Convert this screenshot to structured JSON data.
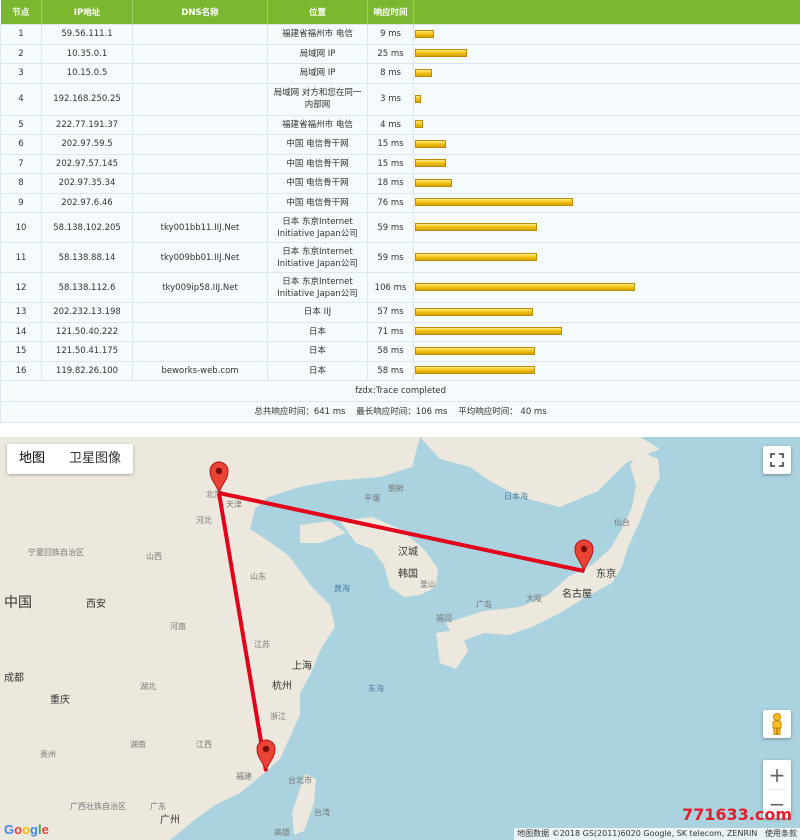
{
  "table": {
    "headers": [
      "节点",
      "IP地址",
      "DNS名称",
      "位置",
      "响应时间",
      ""
    ],
    "max_ms": 106,
    "rows": [
      {
        "hop": "1",
        "ip": "59.56.111.1",
        "dns": "",
        "loc": "福建省福州市 电信",
        "time": "9 ms",
        "ms": 9
      },
      {
        "hop": "2",
        "ip": "10.35.0.1",
        "dns": "",
        "loc": "局域网 IP",
        "time": "25 ms",
        "ms": 25
      },
      {
        "hop": "3",
        "ip": "10.15.0.5",
        "dns": "",
        "loc": "局域网 IP",
        "time": "8 ms",
        "ms": 8
      },
      {
        "hop": "4",
        "ip": "192.168.250.25",
        "dns": "",
        "loc": "局域网 对方和您在同一内部网",
        "time": "3 ms",
        "ms": 3
      },
      {
        "hop": "5",
        "ip": "222.77.191.37",
        "dns": "",
        "loc": "福建省福州市 电信",
        "time": "4 ms",
        "ms": 4
      },
      {
        "hop": "6",
        "ip": "202.97.59.5",
        "dns": "",
        "loc": "中国 电信骨干网",
        "time": "15 ms",
        "ms": 15
      },
      {
        "hop": "7",
        "ip": "202.97.57.145",
        "dns": "",
        "loc": "中国 电信骨干网",
        "time": "15 ms",
        "ms": 15
      },
      {
        "hop": "8",
        "ip": "202.97.35.34",
        "dns": "",
        "loc": "中国 电信骨干网",
        "time": "18 ms",
        "ms": 18
      },
      {
        "hop": "9",
        "ip": "202.97.6.46",
        "dns": "",
        "loc": "中国 电信骨干网",
        "time": "76 ms",
        "ms": 76
      },
      {
        "hop": "10",
        "ip": "58.138.102.205",
        "dns": "tky001bb11.IIJ.Net",
        "loc": "日本 东京Internet Initiative Japan公司",
        "time": "59 ms",
        "ms": 59
      },
      {
        "hop": "11",
        "ip": "58.138.88.14",
        "dns": "tky009bb01.IIJ.Net",
        "loc": "日本 东京Internet Initiative Japan公司",
        "time": "59 ms",
        "ms": 59
      },
      {
        "hop": "12",
        "ip": "58.138.112.6",
        "dns": "tky009ip58.IIJ.Net",
        "loc": "日本 东京Internet Initiative Japan公司",
        "time": "106 ms",
        "ms": 106
      },
      {
        "hop": "13",
        "ip": "202.232.13.198",
        "dns": "",
        "loc": "日本 IIJ",
        "time": "57 ms",
        "ms": 57
      },
      {
        "hop": "14",
        "ip": "121.50.40.222",
        "dns": "",
        "loc": "日本",
        "time": "71 ms",
        "ms": 71
      },
      {
        "hop": "15",
        "ip": "121.50.41.175",
        "dns": "",
        "loc": "日本",
        "time": "58 ms",
        "ms": 58
      },
      {
        "hop": "16",
        "ip": "119.82.26.100",
        "dns": "beworks-web.com",
        "loc": "日本",
        "time": "58 ms",
        "ms": 58
      }
    ],
    "completed": "fzdx:Trace completed",
    "summary": "总共响应时间：641 ms    最长响应时间：106 ms    平均响应时间： 40 ms"
  },
  "map": {
    "map_button": "地图",
    "satellite_button": "卫星图像",
    "fullscreen_icon": "fullscreen-icon",
    "pegman_icon": "pegman-icon",
    "zoom_in": "+",
    "zoom_out": "−",
    "google": [
      "G",
      "o",
      "o",
      "g",
      "l",
      "e"
    ],
    "google_colors": [
      "#4285f4",
      "#ea4335",
      "#fbbc05",
      "#4285f4",
      "#34a853",
      "#ea4335"
    ],
    "attribution": "地图数据 ©2018 GS(2011)6020 Google, SK telecom, ZENRIN   使用条款",
    "watermark": "771633.com",
    "route_color": "#e3001b",
    "labels": [
      {
        "t": "北京"
      },
      {
        "t": "天津"
      },
      {
        "t": "平壤"
      },
      {
        "t": "朝鲜"
      },
      {
        "t": "日本海"
      },
      {
        "t": "仙台"
      },
      {
        "t": "东京"
      },
      {
        "t": "名古屋"
      },
      {
        "t": "大阪"
      },
      {
        "t": "广岛"
      },
      {
        "t": "福冈"
      },
      {
        "t": "汉城"
      },
      {
        "t": "韩国"
      },
      {
        "t": "釜山"
      },
      {
        "t": "黄海"
      },
      {
        "t": "东海"
      },
      {
        "t": "上海"
      },
      {
        "t": "杭州"
      },
      {
        "t": "台北市"
      },
      {
        "t": "台湾"
      },
      {
        "t": "高雄"
      },
      {
        "t": "广州"
      },
      {
        "t": "西安"
      },
      {
        "t": "成都"
      },
      {
        "t": "重庆"
      },
      {
        "t": "中国"
      },
      {
        "t": "宁夏回族自治区"
      },
      {
        "t": "山西"
      },
      {
        "t": "河北"
      },
      {
        "t": "山东"
      },
      {
        "t": "河南"
      },
      {
        "t": "湖北"
      },
      {
        "t": "江苏"
      },
      {
        "t": "浙江"
      },
      {
        "t": "江西"
      },
      {
        "t": "福建"
      },
      {
        "t": "湖南"
      },
      {
        "t": "贵州"
      },
      {
        "t": "广西壮族自治区"
      },
      {
        "t": "广东"
      }
    ]
  }
}
